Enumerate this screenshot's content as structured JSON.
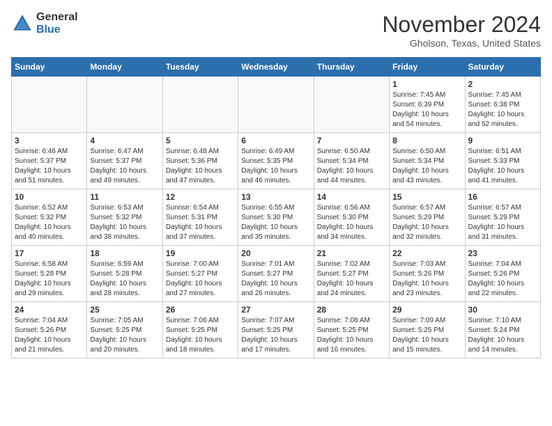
{
  "header": {
    "logo_general": "General",
    "logo_blue": "Blue",
    "month_title": "November 2024",
    "location": "Gholson, Texas, United States"
  },
  "weekdays": [
    "Sunday",
    "Monday",
    "Tuesday",
    "Wednesday",
    "Thursday",
    "Friday",
    "Saturday"
  ],
  "weeks": [
    [
      {
        "day": "",
        "info": ""
      },
      {
        "day": "",
        "info": ""
      },
      {
        "day": "",
        "info": ""
      },
      {
        "day": "",
        "info": ""
      },
      {
        "day": "",
        "info": ""
      },
      {
        "day": "1",
        "info": "Sunrise: 7:45 AM\nSunset: 6:39 PM\nDaylight: 10 hours and 54 minutes."
      },
      {
        "day": "2",
        "info": "Sunrise: 7:45 AM\nSunset: 6:38 PM\nDaylight: 10 hours and 52 minutes."
      }
    ],
    [
      {
        "day": "3",
        "info": "Sunrise: 6:46 AM\nSunset: 5:37 PM\nDaylight: 10 hours and 51 minutes."
      },
      {
        "day": "4",
        "info": "Sunrise: 6:47 AM\nSunset: 5:37 PM\nDaylight: 10 hours and 49 minutes."
      },
      {
        "day": "5",
        "info": "Sunrise: 6:48 AM\nSunset: 5:36 PM\nDaylight: 10 hours and 47 minutes."
      },
      {
        "day": "6",
        "info": "Sunrise: 6:49 AM\nSunset: 5:35 PM\nDaylight: 10 hours and 46 minutes."
      },
      {
        "day": "7",
        "info": "Sunrise: 6:50 AM\nSunset: 5:34 PM\nDaylight: 10 hours and 44 minutes."
      },
      {
        "day": "8",
        "info": "Sunrise: 6:50 AM\nSunset: 5:34 PM\nDaylight: 10 hours and 43 minutes."
      },
      {
        "day": "9",
        "info": "Sunrise: 6:51 AM\nSunset: 5:33 PM\nDaylight: 10 hours and 41 minutes."
      }
    ],
    [
      {
        "day": "10",
        "info": "Sunrise: 6:52 AM\nSunset: 5:32 PM\nDaylight: 10 hours and 40 minutes."
      },
      {
        "day": "11",
        "info": "Sunrise: 6:53 AM\nSunset: 5:32 PM\nDaylight: 10 hours and 38 minutes."
      },
      {
        "day": "12",
        "info": "Sunrise: 6:54 AM\nSunset: 5:31 PM\nDaylight: 10 hours and 37 minutes."
      },
      {
        "day": "13",
        "info": "Sunrise: 6:55 AM\nSunset: 5:30 PM\nDaylight: 10 hours and 35 minutes."
      },
      {
        "day": "14",
        "info": "Sunrise: 6:56 AM\nSunset: 5:30 PM\nDaylight: 10 hours and 34 minutes."
      },
      {
        "day": "15",
        "info": "Sunrise: 6:57 AM\nSunset: 5:29 PM\nDaylight: 10 hours and 32 minutes."
      },
      {
        "day": "16",
        "info": "Sunrise: 6:57 AM\nSunset: 5:29 PM\nDaylight: 10 hours and 31 minutes."
      }
    ],
    [
      {
        "day": "17",
        "info": "Sunrise: 6:58 AM\nSunset: 5:28 PM\nDaylight: 10 hours and 29 minutes."
      },
      {
        "day": "18",
        "info": "Sunrise: 6:59 AM\nSunset: 5:28 PM\nDaylight: 10 hours and 28 minutes."
      },
      {
        "day": "19",
        "info": "Sunrise: 7:00 AM\nSunset: 5:27 PM\nDaylight: 10 hours and 27 minutes."
      },
      {
        "day": "20",
        "info": "Sunrise: 7:01 AM\nSunset: 5:27 PM\nDaylight: 10 hours and 26 minutes."
      },
      {
        "day": "21",
        "info": "Sunrise: 7:02 AM\nSunset: 5:27 PM\nDaylight: 10 hours and 24 minutes."
      },
      {
        "day": "22",
        "info": "Sunrise: 7:03 AM\nSunset: 5:26 PM\nDaylight: 10 hours and 23 minutes."
      },
      {
        "day": "23",
        "info": "Sunrise: 7:04 AM\nSunset: 5:26 PM\nDaylight: 10 hours and 22 minutes."
      }
    ],
    [
      {
        "day": "24",
        "info": "Sunrise: 7:04 AM\nSunset: 5:26 PM\nDaylight: 10 hours and 21 minutes."
      },
      {
        "day": "25",
        "info": "Sunrise: 7:05 AM\nSunset: 5:25 PM\nDaylight: 10 hours and 20 minutes."
      },
      {
        "day": "26",
        "info": "Sunrise: 7:06 AM\nSunset: 5:25 PM\nDaylight: 10 hours and 18 minutes."
      },
      {
        "day": "27",
        "info": "Sunrise: 7:07 AM\nSunset: 5:25 PM\nDaylight: 10 hours and 17 minutes."
      },
      {
        "day": "28",
        "info": "Sunrise: 7:08 AM\nSunset: 5:25 PM\nDaylight: 10 hours and 16 minutes."
      },
      {
        "day": "29",
        "info": "Sunrise: 7:09 AM\nSunset: 5:25 PM\nDaylight: 10 hours and 15 minutes."
      },
      {
        "day": "30",
        "info": "Sunrise: 7:10 AM\nSunset: 5:24 PM\nDaylight: 10 hours and 14 minutes."
      }
    ]
  ]
}
